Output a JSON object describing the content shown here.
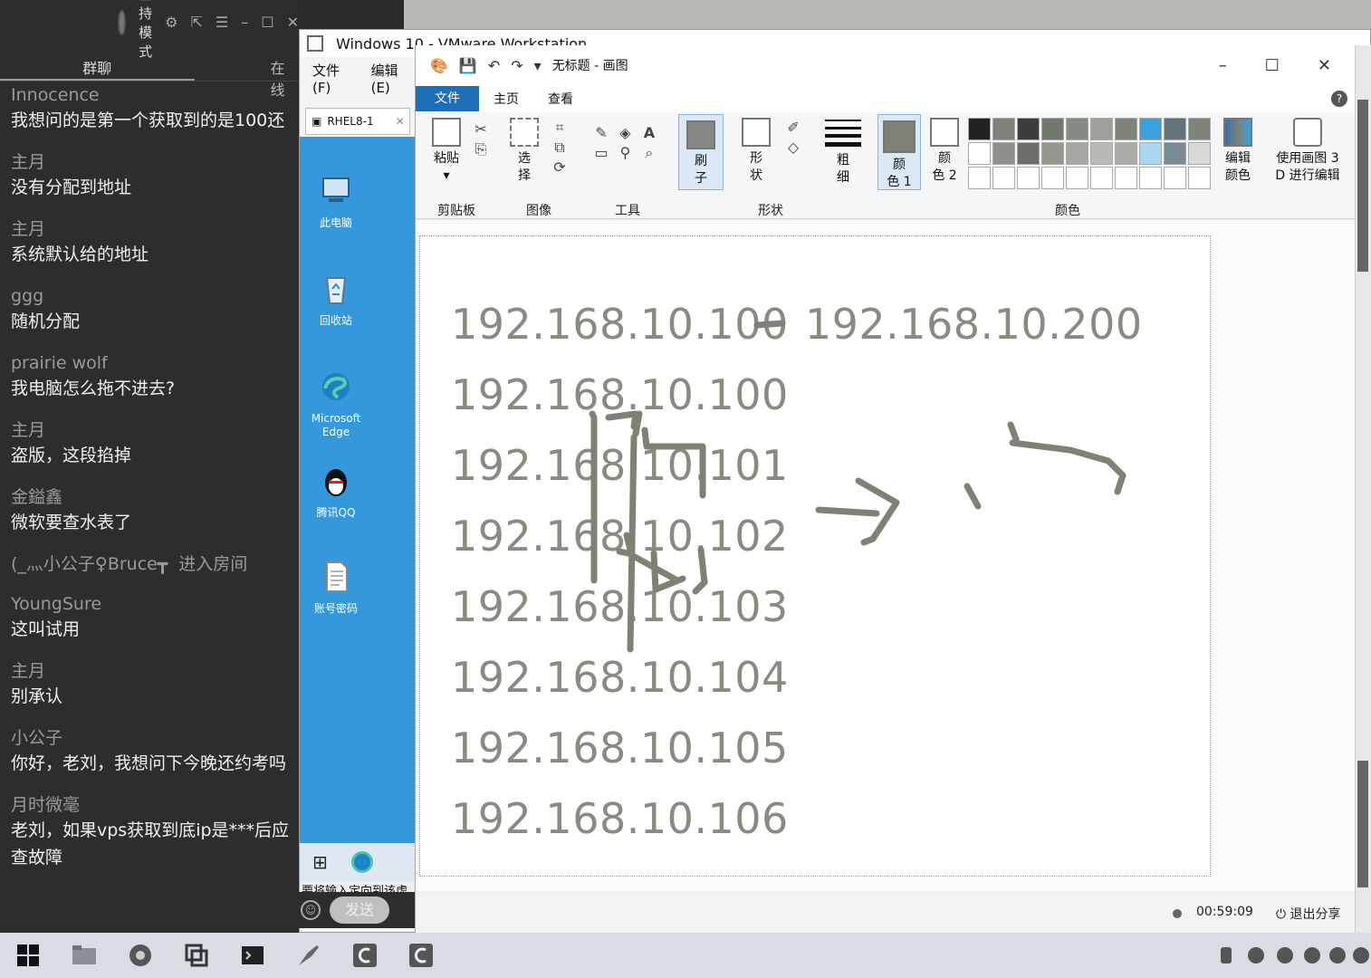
{
  "chat": {
    "host_mode_label": "主持模式",
    "tabs": [
      "群聊",
      "在线"
    ],
    "messages": [
      {
        "name": "Innocence",
        "text": "我想问的是第一个获取到的是100还"
      },
      {
        "name": "主月",
        "text": "没有分配到地址"
      },
      {
        "name": "主月",
        "text": "系统默认给的地址"
      },
      {
        "name": "ggg",
        "text": "随机分配"
      },
      {
        "name": "prairie wolf",
        "text": "我电脑怎么拖不进去?"
      },
      {
        "name": "主月",
        "text": "盗版，这段掐掉"
      },
      {
        "name": "金鎰鑫",
        "text": "微软要查水表了"
      }
    ],
    "system_msg": {
      "user": "(_灬小公子♀Bruce┳",
      "action": "进入房间"
    },
    "messages2": [
      {
        "name": "YoungSure",
        "text": "这叫试用"
      },
      {
        "name": "主月",
        "text": "别承认"
      },
      {
        "name": "小公子",
        "text": "你好，老刘，我想问下今晚还约考吗"
      },
      {
        "name": "月时微毫",
        "text": "老刘，如果vps获取到底ip是***后应",
        "text2": "查故障"
      }
    ],
    "send_label": "发送"
  },
  "vmware": {
    "title": "Windows 10 - VMware Workstation",
    "menu": [
      "文件(F)",
      "编辑(E)"
    ],
    "tab_label": "RHEL8-1",
    "guest_icons": [
      {
        "label": "此电脑",
        "icon": "computer-icon"
      },
      {
        "label": "回收站",
        "icon": "recycle-bin-icon"
      },
      {
        "label": "Microsoft Edge",
        "icon": "edge-icon"
      },
      {
        "label": "腾讯QQ",
        "icon": "qq-icon"
      },
      {
        "label": "账号密码",
        "icon": "document-icon"
      }
    ],
    "status_text": "要将输入定向到该虚"
  },
  "paint": {
    "title": "无标题 - 画图",
    "tabs": {
      "file": "文件",
      "home": "主页",
      "view": "查看"
    },
    "ribbon": {
      "paste": "粘贴",
      "select_1": "选",
      "select_2": "择",
      "brush_1": "刷",
      "brush_2": "子",
      "shapes_1": "形",
      "shapes_2": "状",
      "size_1": "粗",
      "size_2": "细",
      "color1_1": "颜",
      "color1_2": "色 1",
      "color2_1": "颜",
      "color2_2": "色 2",
      "edit_colors_1": "编辑",
      "edit_colors_2": "颜色",
      "paint3d_1": "使用画图 3",
      "paint3d_2": "D 进行编辑"
    },
    "groups": {
      "clipboard": "剪贴板",
      "image": "图像",
      "tools": "工具",
      "shapes": "形状",
      "colors": "颜色"
    },
    "palette_row1": [
      "#222222",
      "#7f8278",
      "#3b3d3b",
      "#6f7a6c",
      "#858b82",
      "#9da19a",
      "#7d857a",
      "#3ba0e0",
      "#65737a",
      "#7f8478"
    ],
    "palette_row2": [
      "#ffffff",
      "#8d9189",
      "#6c7068",
      "#94988f",
      "#a4a8a0",
      "#b9bcb5",
      "#a9ada5",
      "#a9d6f0",
      "#7a8a92",
      "#d9dbd6"
    ],
    "canvas_lines": [
      "192.168.10.100",
      "192.168.10.100",
      "192.168.10.101",
      "192.168.10.102",
      "192.168.10.103",
      "192.168.10.104",
      "192.168.10.105",
      "192.168.10.106"
    ],
    "canvas_line1_tail": "192.168.10.200",
    "timer": "00:59:09",
    "exit_share": "退出分享"
  },
  "colors": {
    "chat_bg": "#2d2d2d",
    "guest_desktop": "#3598dc",
    "paint_file_tab": "#1c6fb8",
    "ink": "#7d8275"
  }
}
